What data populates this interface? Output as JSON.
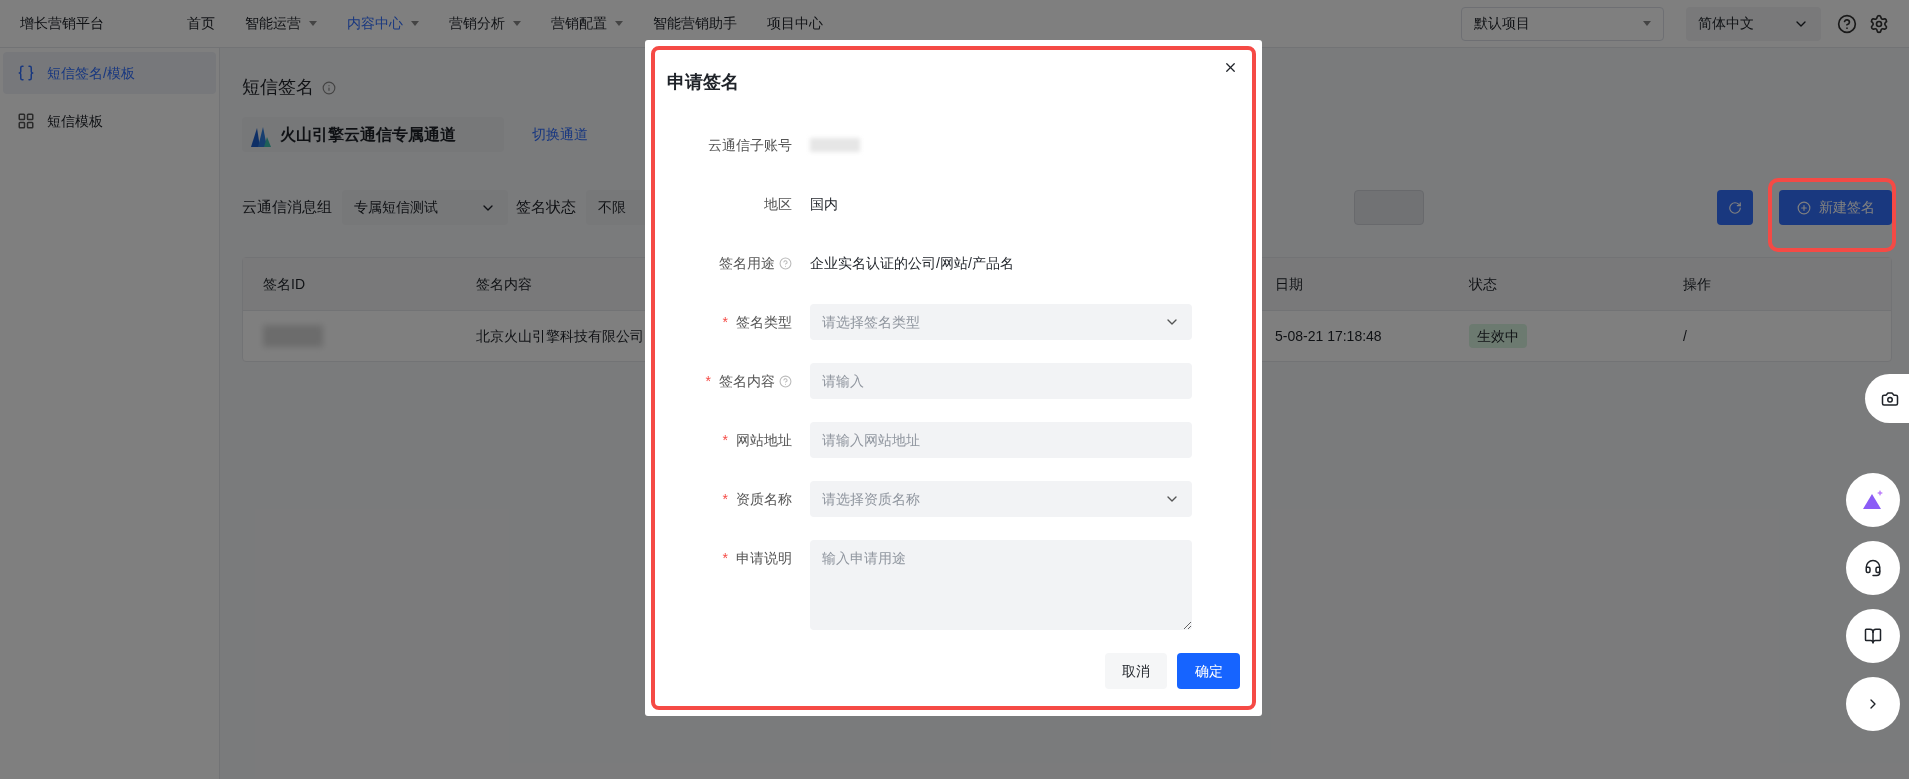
{
  "app": {
    "title": "增长营销平台"
  },
  "nav": [
    {
      "label": "首页",
      "selected": false,
      "dropdown": false
    },
    {
      "label": "智能运营",
      "selected": false,
      "dropdown": true
    },
    {
      "label": "内容中心",
      "selected": true,
      "dropdown": true
    },
    {
      "label": "营销分析",
      "selected": false,
      "dropdown": true
    },
    {
      "label": "营销配置",
      "selected": false,
      "dropdown": true
    },
    {
      "label": "智能营销助手",
      "selected": false,
      "dropdown": false
    },
    {
      "label": "项目中心",
      "selected": false,
      "dropdown": false
    }
  ],
  "project_select": {
    "value": "默认项目"
  },
  "language_select": {
    "value": "简体中文"
  },
  "sidebar": {
    "items": [
      {
        "label": "短信签名/模板",
        "selected": true,
        "kind": "braces"
      },
      {
        "label": "短信模板",
        "selected": false,
        "kind": "grid"
      }
    ]
  },
  "page": {
    "title": "短信签名",
    "channel": {
      "name": "火山引擎云通信专属通道",
      "switch_link": "切换通道"
    },
    "filters": [
      {
        "label": "云通信消息组",
        "value": "专属短信测试"
      },
      {
        "label": "签名状态",
        "value": "不限"
      }
    ],
    "create_button": "新建签名"
  },
  "table": {
    "columns": [
      "签名ID",
      "签名内容",
      "日期",
      "状态",
      "操作"
    ],
    "rows": [
      {
        "content": "北京火山引擎科技有限公司",
        "date": "5-08-21 17:18:48",
        "status": "生效中",
        "action": "/"
      }
    ]
  },
  "modal": {
    "title": "申请签名",
    "fields": [
      {
        "kind": "redacted",
        "label": "云通信子账号",
        "help": false
      },
      {
        "kind": "text",
        "label": "地区",
        "value": "国内",
        "help": false
      },
      {
        "kind": "text",
        "label": "签名用途",
        "value": "企业实名认证的公司/网站/产品名",
        "help": true
      },
      {
        "kind": "select",
        "label": "签名类型",
        "required_mark": "*",
        "placeholder": "请选择签名类型",
        "help": false
      },
      {
        "kind": "input",
        "label": "签名内容",
        "required_mark": "*",
        "placeholder": "请输入",
        "help": true
      },
      {
        "kind": "input",
        "label": "网站地址",
        "required_mark": "*",
        "placeholder": "请输入网站地址",
        "help": false
      },
      {
        "kind": "select",
        "label": "资质名称",
        "required_mark": "*",
        "placeholder": "请选择资质名称",
        "help": false
      },
      {
        "kind": "textarea",
        "label": "申请说明",
        "required_mark": "*",
        "placeholder": "输入申请用途",
        "help": false
      }
    ],
    "cancel_button": "取消",
    "confirm_button": "确定"
  }
}
